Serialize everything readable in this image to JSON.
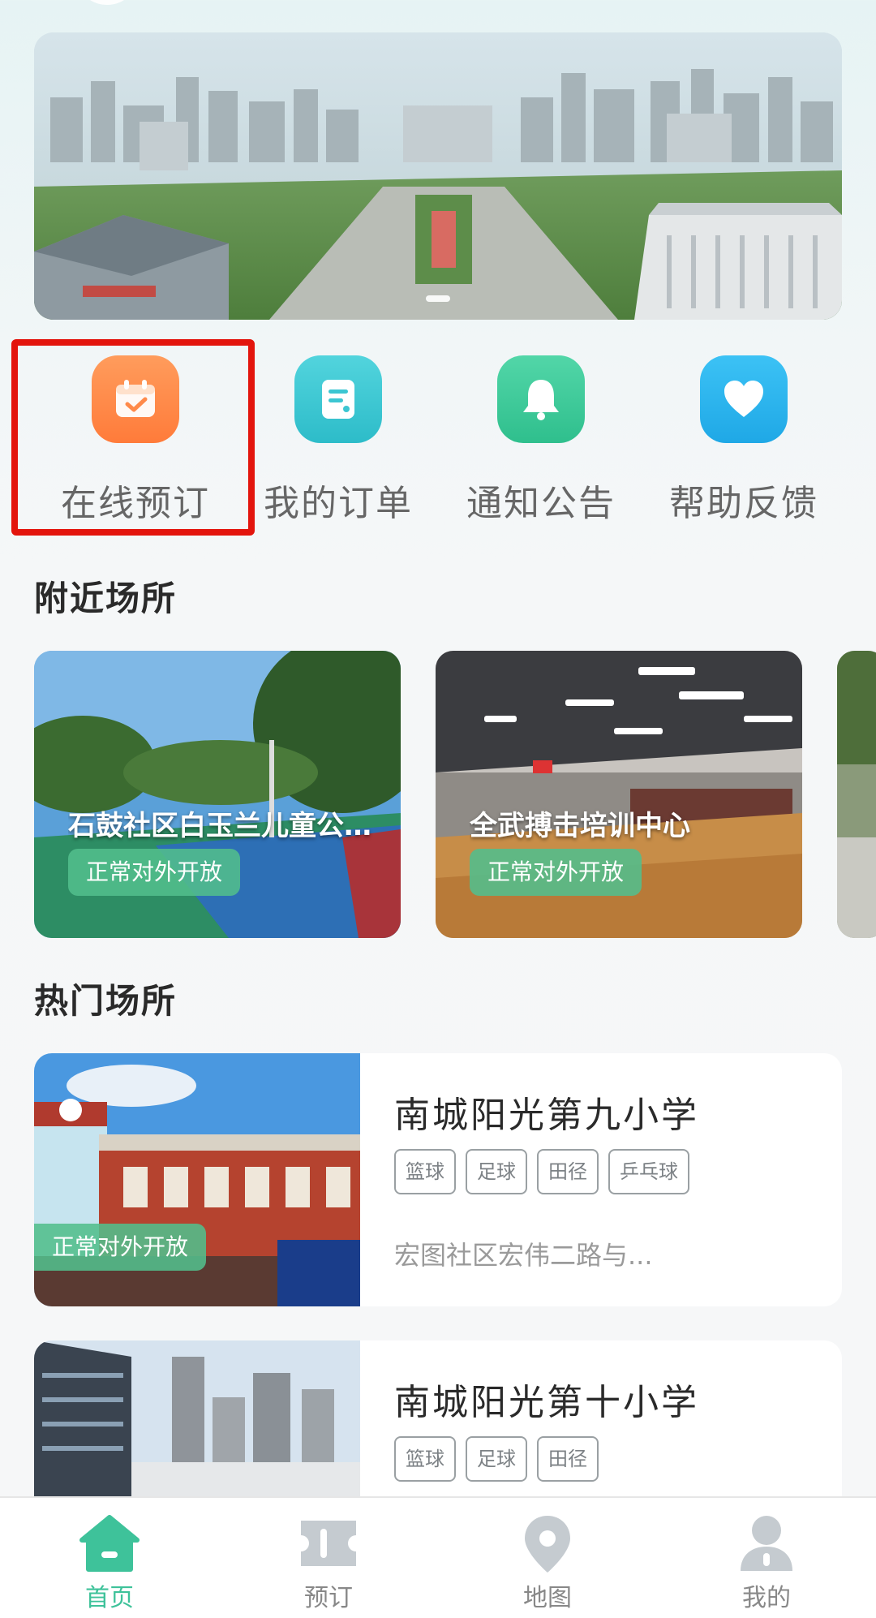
{
  "quick_actions": [
    {
      "label": "在线预订",
      "icon": "calendar-check-icon",
      "color": "#ff8a4a"
    },
    {
      "label": "我的订单",
      "icon": "order-list-icon",
      "color": "#3cc6d2"
    },
    {
      "label": "通知公告",
      "icon": "bell-icon",
      "color": "#3cc898"
    },
    {
      "label": "帮助反馈",
      "icon": "heart-icon",
      "color": "#2cb6ef"
    }
  ],
  "sections": {
    "nearby_title": "附近场所",
    "hot_title": "热门场所"
  },
  "nearby_venues": [
    {
      "name": "石鼓社区白玉兰儿童公园篮球场",
      "status": "正常对外开放"
    },
    {
      "name": "全武搏击培训中心",
      "status": "正常对外开放"
    }
  ],
  "hot_venues": [
    {
      "name": "南城阳光第九小学",
      "tags": [
        "篮球",
        "足球",
        "田径",
        "乒乓球"
      ],
      "address": "宏图社区宏伟二路与...",
      "status": "正常对外开放"
    },
    {
      "name": "南城阳光第十小学",
      "tags": [
        "篮球",
        "足球",
        "田径"
      ]
    }
  ],
  "nav": [
    {
      "label": "首页",
      "icon": "home-icon",
      "active": true
    },
    {
      "label": "预订",
      "icon": "ticket-icon",
      "active": false
    },
    {
      "label": "地图",
      "icon": "map-pin-icon",
      "active": false
    },
    {
      "label": "我的",
      "icon": "user-icon",
      "active": false
    }
  ],
  "colors": {
    "accent": "#3ec29a",
    "highlight_box": "#e3150d",
    "open_tag_bg": "#52be8c"
  }
}
